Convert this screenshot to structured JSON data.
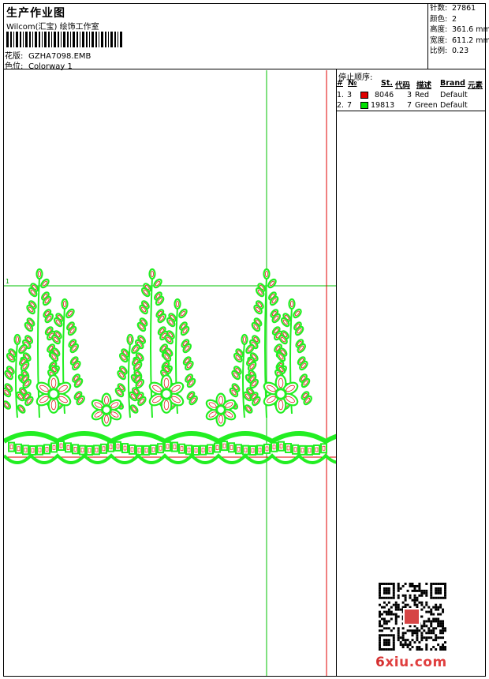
{
  "header": {
    "title": "生产作业图",
    "company": "Wilcom(汇宝) 绘饰工作室",
    "pattern_label": "花版:",
    "pattern_value": "GZHA7098.EMB",
    "colorway_label": "色位:",
    "colorway_value": "Colorway 1"
  },
  "info": {
    "stitches_label": "针数:",
    "stitches_value": "27861",
    "colors_label": "颜色:",
    "colors_value": "2",
    "height_label": "高度:",
    "height_value": "361.6 mm",
    "width_label": "宽度:",
    "width_value": "611.2 mm",
    "ratio_label": "比例:",
    "ratio_value": "0.23"
  },
  "stop_sequence": {
    "title": "停止顺序:",
    "columns": [
      "#",
      "№",
      "St.",
      "代码",
      "描述",
      "Brand",
      "元素"
    ],
    "rows": [
      {
        "idx": "1.",
        "no": "3",
        "color": "#e00000",
        "st": "8046",
        "code": "3",
        "desc": "Red",
        "brand": "Default"
      },
      {
        "idx": "2.",
        "no": "7",
        "color": "#00e000",
        "st": "19813",
        "code": "7",
        "desc": "Green",
        "brand": "Default"
      }
    ]
  },
  "canvas": {
    "marker_label": "1",
    "guide_color": "#00c000",
    "red_line_color": "#e00000"
  },
  "watermark": {
    "six": "6",
    "rest": "xiu.com"
  }
}
